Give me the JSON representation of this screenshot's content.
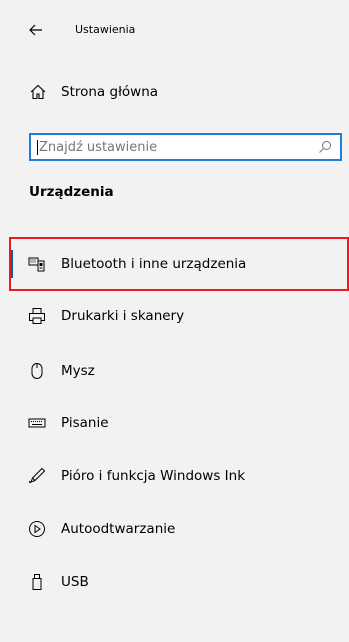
{
  "header": {
    "title": "Ustawienia",
    "back_icon": "arrow-left-icon"
  },
  "home": {
    "label": "Strona główna",
    "icon": "home-icon"
  },
  "search": {
    "placeholder": "Znajdź ustawienie",
    "icon": "search-icon"
  },
  "section_title": "Urządzenia",
  "nav": {
    "items": [
      {
        "label": "Bluetooth i inne urządzenia",
        "icon": "bluetooth-devices-icon",
        "selected": true
      },
      {
        "label": "Drukarki i skanery",
        "icon": "printer-icon",
        "selected": false
      },
      {
        "label": "Mysz",
        "icon": "mouse-icon",
        "selected": false
      },
      {
        "label": "Pisanie",
        "icon": "keyboard-icon",
        "selected": false
      },
      {
        "label": "Pióro i funkcja Windows Ink",
        "icon": "pen-icon",
        "selected": false
      },
      {
        "label": "Autoodtwarzanie",
        "icon": "autoplay-icon",
        "selected": false
      },
      {
        "label": "USB",
        "icon": "usb-icon",
        "selected": false
      }
    ]
  },
  "colors": {
    "background": "#f2f2f2",
    "search_border": "#1f7fd6",
    "selection_accent": "#0063b1",
    "highlight_border": "#e8191f"
  }
}
